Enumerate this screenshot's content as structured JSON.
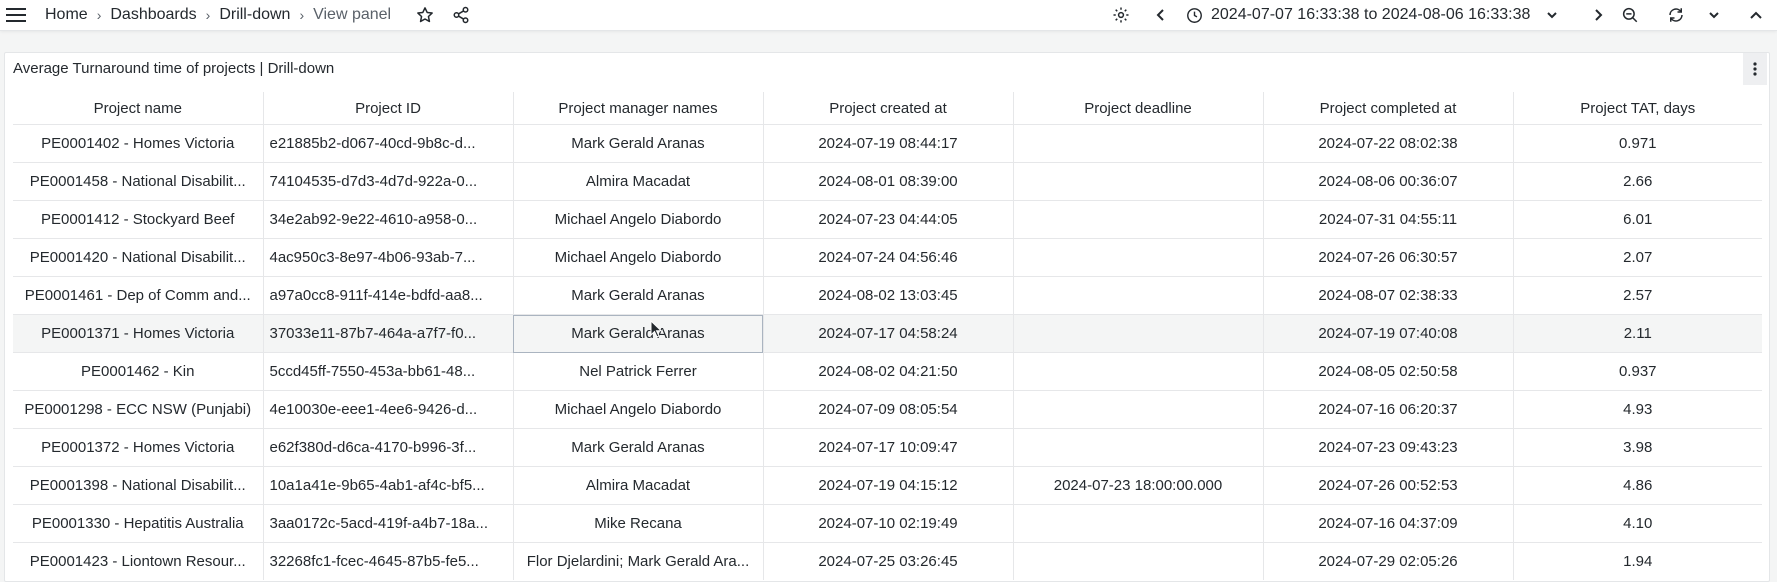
{
  "breadcrumb": {
    "items": [
      "Home",
      "Dashboards",
      "Drill-down"
    ],
    "current": "View panel"
  },
  "toolbar": {
    "time_range": "2024-07-07 16:33:38 to 2024-08-06 16:33:38"
  },
  "icons": {
    "menu": "hamburger-menu-icon",
    "star": "star-icon",
    "share": "share-icon",
    "settings": "gear-icon",
    "prev": "chevron-left-icon",
    "clock": "clock-icon",
    "dropdown": "chevron-down-icon",
    "next": "chevron-right-icon",
    "zoom_out": "zoom-out-icon",
    "refresh": "refresh-icon",
    "refresh_dropdown": "chevron-down-icon",
    "collapse": "chevron-up-icon",
    "panel_menu": "kebab-menu-icon"
  },
  "panel": {
    "title": "Average Turnaround time of projects | Drill-down"
  },
  "table": {
    "columns": [
      "Project name",
      "Project ID",
      "Project manager names",
      "Project created at",
      "Project deadline",
      "Project completed at",
      "Project TAT, days"
    ],
    "rows": [
      [
        "PE0001402 - Homes Victoria",
        "e21885b2-d067-40cd-9b8c-d...",
        "Mark Gerald Aranas",
        "2024-07-19 08:44:17",
        "",
        "2024-07-22 08:02:38",
        "0.971"
      ],
      [
        "PE0001458 - National Disabilit...",
        "74104535-d7d3-4d7d-922a-0...",
        "Almira Macadat",
        "2024-08-01 08:39:00",
        "",
        "2024-08-06 00:36:07",
        "2.66"
      ],
      [
        "PE0001412 - Stockyard Beef",
        "34e2ab92-9e22-4610-a958-0...",
        "Michael Angelo Diabordo",
        "2024-07-23 04:44:05",
        "",
        "2024-07-31 04:55:11",
        "6.01"
      ],
      [
        "PE0001420 - National Disabilit...",
        "4ac950c3-8e97-4b06-93ab-7...",
        "Michael Angelo Diabordo",
        "2024-07-24 04:56:46",
        "",
        "2024-07-26 06:30:57",
        "2.07"
      ],
      [
        "PE0001461 - Dep of Comm and...",
        "a97a0cc8-911f-414e-bdfd-aa8...",
        "Mark Gerald Aranas",
        "2024-08-02 13:03:45",
        "",
        "2024-08-07 02:38:33",
        "2.57"
      ],
      [
        "PE0001371 - Homes Victoria",
        "37033e11-87b7-464a-a7f7-f0...",
        "Mark Gerald Aranas",
        "2024-07-17 04:58:24",
        "",
        "2024-07-19 07:40:08",
        "2.11"
      ],
      [
        "PE0001462 - Kin",
        "5ccd45ff-7550-453a-bb61-48...",
        "Nel Patrick Ferrer",
        "2024-08-02 04:21:50",
        "",
        "2024-08-05 02:50:58",
        "0.937"
      ],
      [
        "PE0001298 - ECC NSW (Punjabi)",
        "4e10030e-eee1-4ee6-9426-d...",
        "Michael Angelo Diabordo",
        "2024-07-09 08:05:54",
        "",
        "2024-07-16 06:20:37",
        "4.93"
      ],
      [
        "PE0001372 - Homes Victoria",
        "e62f380d-d6ca-4170-b996-3f...",
        "Mark Gerald Aranas",
        "2024-07-17 10:09:47",
        "",
        "2024-07-23 09:43:23",
        "3.98"
      ],
      [
        "PE0001398 - National Disabilit...",
        "10a1a41e-9b65-4ab1-af4c-bf5...",
        "Almira Macadat",
        "2024-07-19 04:15:12",
        "2024-07-23 18:00:00.000",
        "2024-07-26 00:52:53",
        "4.86"
      ],
      [
        "PE0001330 - Hepatitis Australia",
        "3aa0172c-5acd-419f-a4b7-18a...",
        "Mike Recana",
        "2024-07-10 02:19:49",
        "",
        "2024-07-16 04:37:09",
        "4.10"
      ],
      [
        "PE0001423 - Liontown Resour...",
        "32268fc1-fcec-4645-87b5-fe5...",
        "Flor Djelardini; Mark Gerald Ara...",
        "2024-07-25 03:26:45",
        "",
        "2024-07-29 02:05:26",
        "1.94"
      ]
    ]
  }
}
